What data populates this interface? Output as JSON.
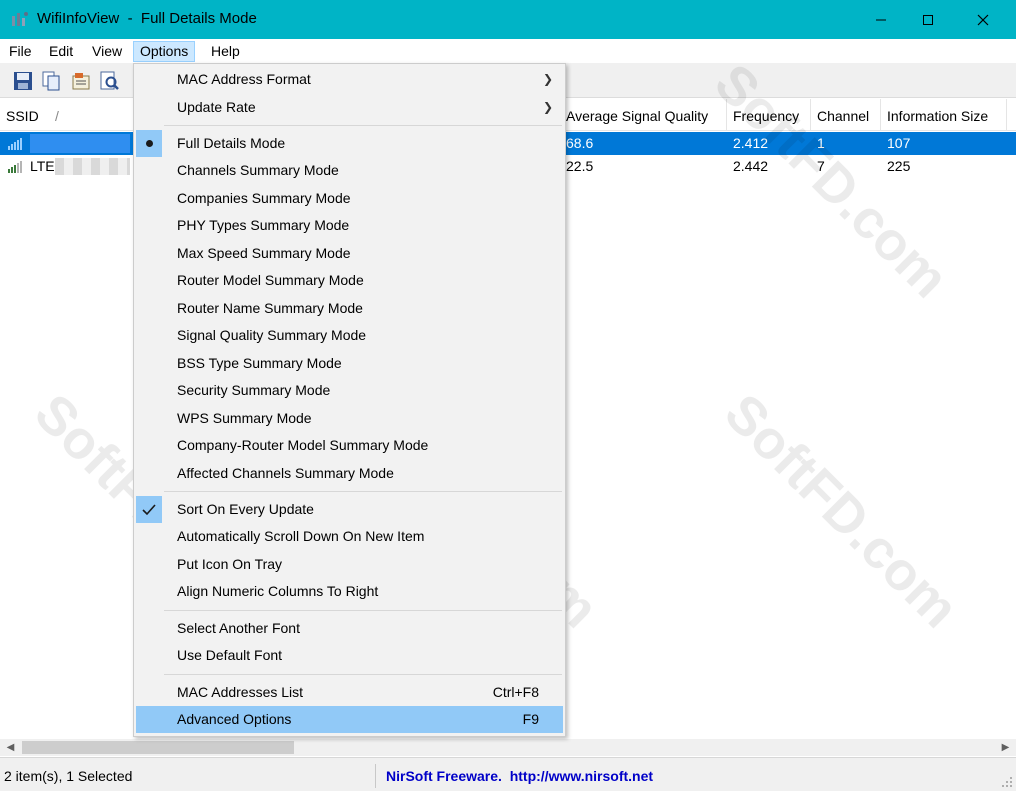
{
  "window": {
    "title": "WifiInfoView  -  Full Details Mode",
    "accent_color": "#00b4c6"
  },
  "menubar": {
    "items": [
      "File",
      "Edit",
      "View",
      "Options",
      "Help"
    ],
    "active": "Options"
  },
  "toolbar": {
    "icons": [
      "save-icon",
      "copy-icon",
      "properties-icon",
      "find-icon"
    ]
  },
  "list": {
    "columns": [
      "SSID",
      "Average Signal Quality",
      "Frequency",
      "Channel",
      "Information Size"
    ],
    "rows": [
      {
        "ssid": "",
        "avg_signal_quality": "68.6",
        "frequency": "2.412",
        "channel": "1",
        "information_size": "107",
        "selected": true
      },
      {
        "ssid": "LTE",
        "avg_signal_quality": "22.5",
        "frequency": "2.442",
        "channel": "7",
        "information_size": "225",
        "selected": false
      }
    ]
  },
  "options_menu": {
    "items": [
      {
        "label": "MAC Address Format",
        "submenu": true
      },
      {
        "label": "Update Rate",
        "submenu": true
      },
      {
        "label": "Full Details Mode",
        "radio": true
      },
      {
        "label": "Channels Summary Mode"
      },
      {
        "label": "Companies Summary Mode"
      },
      {
        "label": "PHY Types Summary Mode"
      },
      {
        "label": "Max Speed Summary Mode"
      },
      {
        "label": "Router Model Summary Mode"
      },
      {
        "label": "Router Name Summary Mode"
      },
      {
        "label": "Signal Quality Summary Mode"
      },
      {
        "label": "BSS Type Summary Mode"
      },
      {
        "label": "Security Summary Mode"
      },
      {
        "label": "WPS Summary Mode"
      },
      {
        "label": "Company-Router Model Summary Mode"
      },
      {
        "label": "Affected Channels Summary Mode"
      },
      {
        "label": "Sort On Every Update",
        "checked": true
      },
      {
        "label": "Automatically Scroll Down On New Item"
      },
      {
        "label": "Put Icon On Tray"
      },
      {
        "label": "Align Numeric Columns To Right"
      },
      {
        "label": "Select Another Font"
      },
      {
        "label": "Use Default Font"
      },
      {
        "label": "MAC Addresses List",
        "shortcut": "Ctrl+F8"
      },
      {
        "label": "Advanced Options",
        "shortcut": "F9",
        "highlighted": true
      }
    ]
  },
  "statusbar": {
    "count_text": "2 item(s), 1 Selected",
    "link_text": "NirSoft Freeware.  http://www.nirsoft.net"
  },
  "watermark": "SoftFD.com",
  "colors": {
    "selection": "#0078d7",
    "menu_highlight": "#91c9f7",
    "status_link": "#0000c8"
  }
}
